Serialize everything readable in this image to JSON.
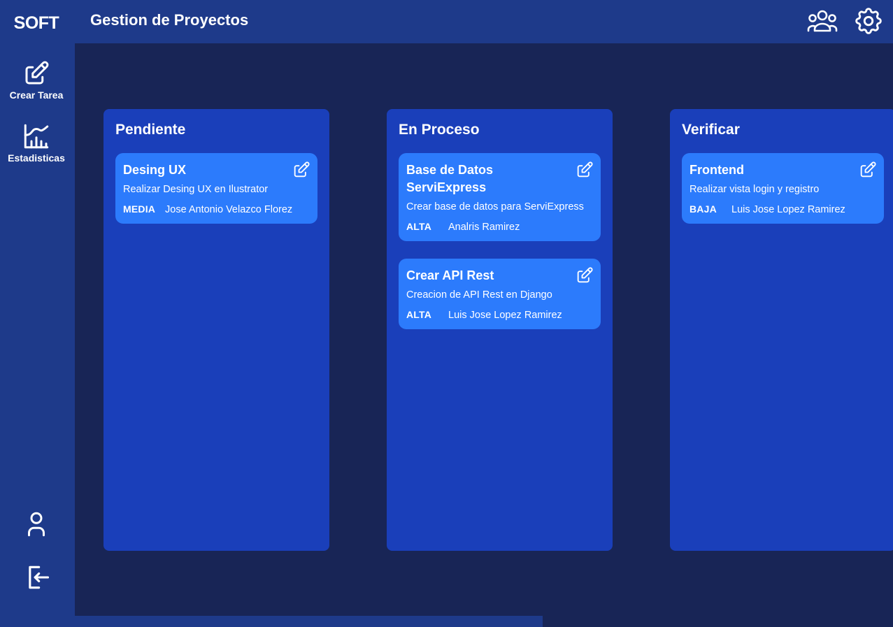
{
  "brand": "SOFT",
  "header": {
    "title": "Gestion de Proyectos",
    "icons": [
      "users-group-icon",
      "gear-icon"
    ]
  },
  "sidebar": {
    "items": [
      {
        "label": "Crear Tarea",
        "icon": "edit-square-icon"
      },
      {
        "label": "Estadisticas",
        "icon": "chart-line-icon"
      }
    ],
    "bottom_icons": [
      "user-icon",
      "logout-icon"
    ]
  },
  "columns": [
    {
      "title": "Pendiente",
      "cards": [
        {
          "title": "Desing UX",
          "description": "Realizar Desing UX en Ilustrator",
          "priority": "MEDIA",
          "assignee": "Jose Antonio Velazco Florez"
        }
      ]
    },
    {
      "title": "En Proceso",
      "cards": [
        {
          "title": "Base de Datos ServiExpress",
          "description": "Crear base de datos para ServiExpress",
          "priority": "ALTA",
          "assignee": "Analris Ramirez"
        },
        {
          "title": "Crear API Rest",
          "description": "Creacion de API Rest en Django",
          "priority": "ALTA",
          "assignee": "Luis Jose Lopez Ramirez"
        }
      ]
    },
    {
      "title": "Verificar",
      "cards": [
        {
          "title": "Frontend",
          "description": "Realizar vista login y registro",
          "priority": "BAJA",
          "assignee": "Luis Jose Lopez Ramirez"
        }
      ]
    }
  ],
  "colors": {
    "background": "#182556",
    "sidebar": "#1e3a8a",
    "column": "#1a3fba",
    "card": "#2c7bfc",
    "text": "#ffffff"
  }
}
